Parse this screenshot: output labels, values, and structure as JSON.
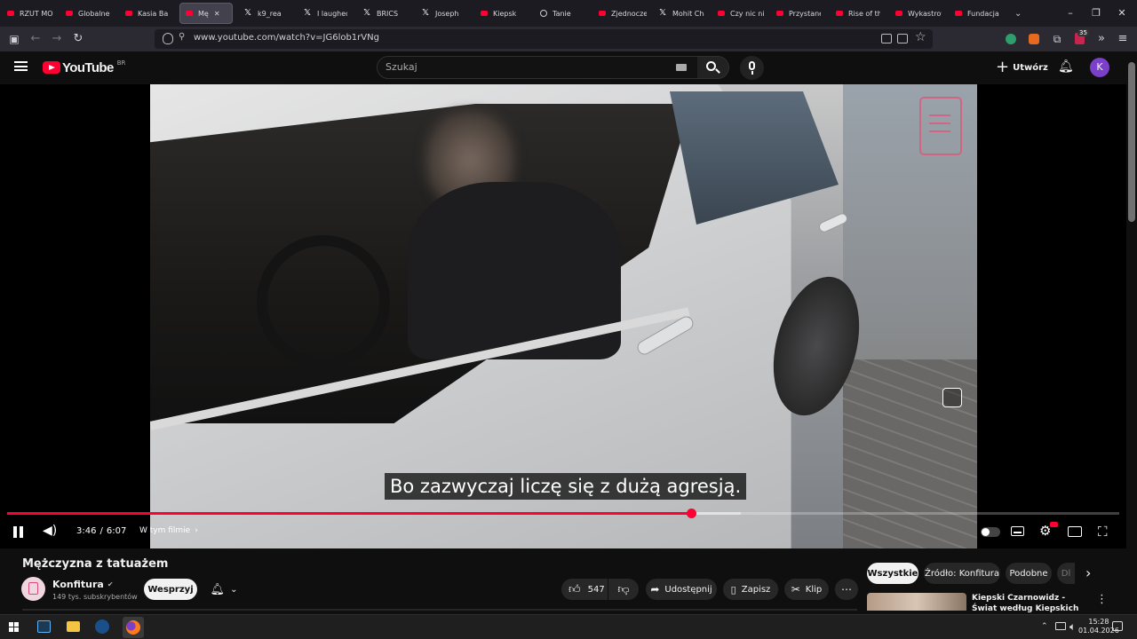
{
  "browser": {
    "tabs": [
      {
        "label": "RZUT MOI",
        "icon": "youtube-icon"
      },
      {
        "label": "Globalne I",
        "icon": "youtube-icon"
      },
      {
        "label": "Kasia Babi",
        "icon": "youtube-icon"
      },
      {
        "label": "Mę",
        "icon": "youtube-icon",
        "active": true
      },
      {
        "label": "k9_rea",
        "icon": "x-icon"
      },
      {
        "label": "I laughed",
        "icon": "x-icon"
      },
      {
        "label": "BRICS",
        "icon": "x-icon"
      },
      {
        "label": "Joseph",
        "icon": "x-icon"
      },
      {
        "label": "Kiepsk",
        "icon": "youtube-icon"
      },
      {
        "label": "Tanie",
        "icon": "globe-icon"
      },
      {
        "label": "Zjednocze",
        "icon": "youtube-icon"
      },
      {
        "label": "Mohit Cha",
        "icon": "x-icon"
      },
      {
        "label": "Czy nic nie",
        "icon": "youtube-icon"
      },
      {
        "label": "Przystanek",
        "icon": "youtube-icon"
      },
      {
        "label": "Rise of the",
        "icon": "youtube-icon"
      },
      {
        "label": "Wykastrow",
        "icon": "youtube-icon"
      },
      {
        "label": "Fundacja I",
        "icon": "youtube-icon"
      }
    ],
    "url": "www.youtube.com/watch?v=JG6lob1rVNg",
    "extension_badge": "35"
  },
  "youtube": {
    "logo_text": "YouTube",
    "logo_region": "BR",
    "search_placeholder": "Szukaj",
    "create_label": "Utwórz",
    "avatar_letter": "K",
    "accent": "#ff0033"
  },
  "player": {
    "subtitle": "Bo zazwyczaj liczę się z dużą agresją.",
    "current_time": "3:46",
    "separator": "/",
    "duration": "6:07",
    "chapters_label": "W tym filmie",
    "progress_fraction": 0.615,
    "buffered_fraction": 0.66
  },
  "video_info": {
    "title": "Mężczyzna z tatuażem",
    "channel_name": "Konfitura",
    "subscribers": "149 tys. subskrybentów",
    "support_label": "Wesprzyj",
    "likes": "547",
    "share_label": "Udostępnij",
    "save_label": "Zapisz",
    "clip_label": "Klip"
  },
  "sidebar": {
    "chips": [
      "Wszystkie",
      "Źródło: Konfitura",
      "Podobne",
      "Dl"
    ],
    "recommended": [
      {
        "title": "Kiepski Czarnowidz - Świat według Kiepskich - CAŁY ..."
      }
    ]
  },
  "taskbar": {
    "time": "15:28",
    "date": "01.04.2026"
  }
}
